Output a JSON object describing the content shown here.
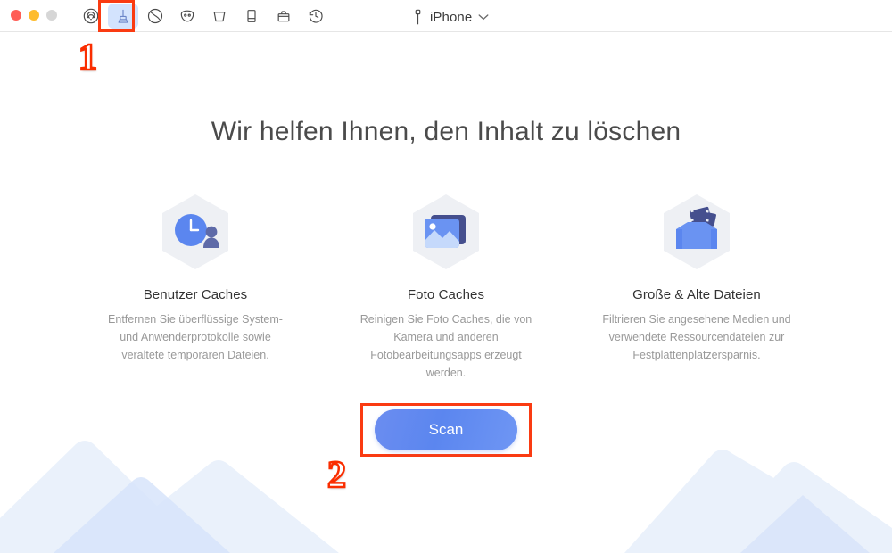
{
  "window": {
    "traffic_lights": [
      {
        "name": "close",
        "color": "#ff5f57"
      },
      {
        "name": "minimize",
        "color": "#febc2e"
      },
      {
        "name": "zoom",
        "color": "#d6d6d6"
      }
    ],
    "toolbar": [
      {
        "icon": "airdrop-icon",
        "label": "AirDrop",
        "selected": false
      },
      {
        "icon": "broom-icon",
        "label": "Clean",
        "selected": true
      },
      {
        "icon": "globe-slash-icon",
        "label": "Privacy",
        "selected": false
      },
      {
        "icon": "mask-icon",
        "label": "Mask",
        "selected": false
      },
      {
        "icon": "trash-bucket-icon",
        "label": "Trash",
        "selected": false
      },
      {
        "icon": "phone-icon",
        "label": "Device",
        "selected": false
      },
      {
        "icon": "toolbox-icon",
        "label": "Toolkit",
        "selected": false
      },
      {
        "icon": "clock-history-icon",
        "label": "History",
        "selected": false
      }
    ],
    "device_selector": {
      "icon": "lightning-device-icon",
      "label": "iPhone",
      "chevron": "chevron-down-icon"
    }
  },
  "main": {
    "headline": "Wir helfen Ihnen, den Inhalt zu löschen",
    "features": [
      {
        "icon": "user-caches-icon",
        "title": "Benutzer Caches",
        "description": "Entfernen Sie überflüssige System- und Anwenderprotokolle sowie veraltete temporären Dateien."
      },
      {
        "icon": "photo-caches-icon",
        "title": "Foto Caches",
        "description": "Reinigen Sie Foto Caches, die von Kamera und anderen Fotobearbeitungsapps erzeugt werden."
      },
      {
        "icon": "large-old-files-icon",
        "title": "Große & Alte Dateien",
        "description": "Filtrieren Sie angesehene Medien und verwendete Ressourcendateien zur Festplattenplatzersparnis."
      }
    ],
    "scan_button": "Scan"
  },
  "annotations": [
    {
      "name": "step-1",
      "text": "1",
      "target": "broom-toolbar-icon"
    },
    {
      "name": "step-2",
      "text": "2",
      "target": "scan-button"
    }
  ],
  "colors": {
    "accent_blue": "#5b86ef",
    "highlight_red": "#fa3b12",
    "selected_tab_bg": "#d3e3fd",
    "mountain_light": "#eaf1fb",
    "mountain_dark": "#d7e4fa"
  }
}
